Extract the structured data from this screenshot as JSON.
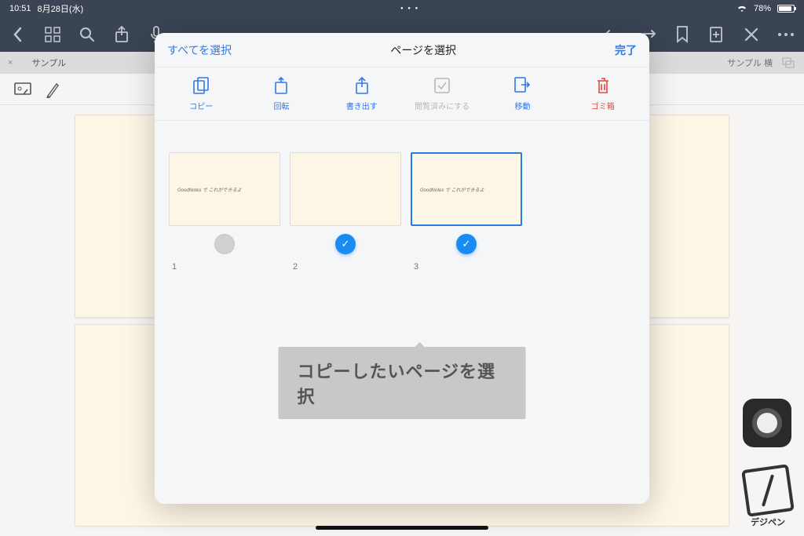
{
  "status": {
    "time": "10:51",
    "date": "8月28日(水)",
    "battery_pct": "78%"
  },
  "tabs": {
    "left": "サンプル",
    "right": "サンプル 横"
  },
  "modal": {
    "select_all": "すべてを選択",
    "title": "ページを選択",
    "done": "完了",
    "actions": {
      "copy": "コピー",
      "rotate": "回転",
      "export": "書き出す",
      "mark_read": "閲覧済みにする",
      "move": "移動",
      "trash": "ゴミ箱"
    },
    "thumbs": [
      {
        "num": "1",
        "text": "GoodNotes で これができるよ",
        "selected": false,
        "badge": false
      },
      {
        "num": "2",
        "text": "",
        "selected": true,
        "badge": true
      },
      {
        "num": "3",
        "text": "GoodNotes で これができるよ",
        "selected": true,
        "badge": true,
        "highlight": true
      }
    ]
  },
  "annotation": {
    "text": "コピーしたいページを選択"
  },
  "logo": {
    "text": "デジペン"
  }
}
